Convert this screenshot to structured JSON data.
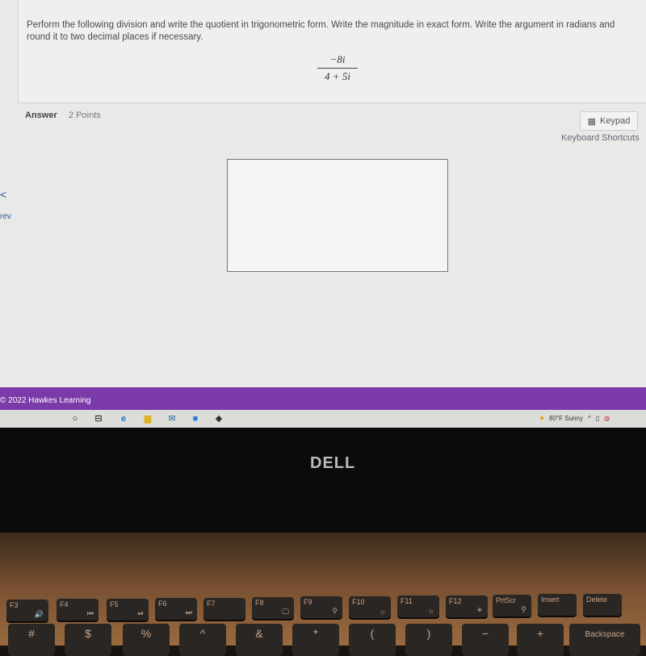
{
  "question": {
    "text": "Perform the following division and write the quotient in trigonometric form. Write the magnitude in exact form. Write the argument in radians and round it to two decimal places if necessary.",
    "numerator": "−8i",
    "denominator": "4 + 5i"
  },
  "answer": {
    "label": "Answer",
    "points": "2 Points",
    "keypad_label": "Keypad",
    "shortcuts_label": "Keyboard Shortcuts"
  },
  "nav": {
    "prev_arrow": "<",
    "prev_label": "rev"
  },
  "footer": {
    "copyright": "© 2022 Hawkes Learning"
  },
  "taskbar": {
    "weather": "80°F  Sunny",
    "colors": {
      "footer": "#7a3aa8"
    }
  },
  "laptop": {
    "brand": "DELL"
  },
  "keyboard": {
    "function_keys": [
      {
        "label": "F3",
        "icon": "🔊"
      },
      {
        "label": "F4",
        "icon": "⏮"
      },
      {
        "label": "F5",
        "icon": "⏯"
      },
      {
        "label": "F6",
        "icon": "⏭"
      },
      {
        "label": "F7",
        "icon": ""
      },
      {
        "label": "F8",
        "icon": "🖵"
      },
      {
        "label": "F9",
        "icon": "⚲"
      },
      {
        "label": "F10",
        "icon": "☼"
      },
      {
        "label": "F11",
        "icon": "☼"
      },
      {
        "label": "F12",
        "icon": "☀"
      },
      {
        "label": "PrtScr",
        "icon": "⚲"
      },
      {
        "label": "Insert",
        "icon": ""
      },
      {
        "label": "Delete",
        "icon": ""
      }
    ],
    "number_keys": [
      "#",
      "$",
      "%",
      "^",
      "&",
      "*",
      "(",
      ")",
      "−",
      "+",
      "Backspace"
    ]
  }
}
